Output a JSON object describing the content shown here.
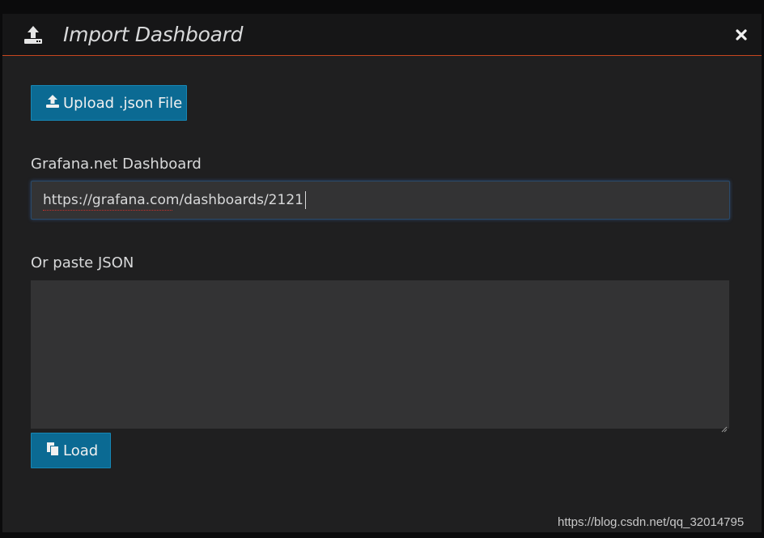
{
  "header": {
    "title": "Import Dashboard",
    "icon": "upload-icon",
    "close_icon": "close-icon"
  },
  "upload_button": {
    "label": "Upload .json File",
    "icon": "upload-icon"
  },
  "grafana_net": {
    "label": "Grafana.net Dashboard",
    "value": "https://grafana.com/dashboards/2121"
  },
  "paste_json": {
    "label": "Or paste JSON",
    "value": ""
  },
  "load_button": {
    "label": "Load",
    "icon": "copy-icon"
  },
  "watermark": "https://blog.csdn.net/qq_32014795",
  "colors": {
    "accent_button": "#0b6a93",
    "header_border": "#c7461f",
    "input_bg": "#333334"
  }
}
